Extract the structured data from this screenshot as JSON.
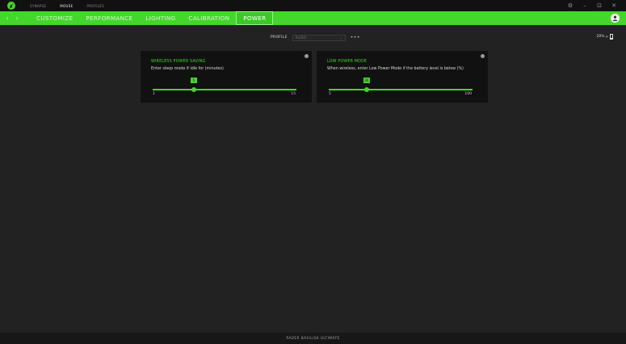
{
  "titlebar": {
    "tabs": [
      {
        "label": "SYNAPSE",
        "active": false
      },
      {
        "label": "MOUSE",
        "active": true
      },
      {
        "label": "PROFILES",
        "active": false
      }
    ],
    "controls": {
      "gear": "⚙",
      "minimize": "–",
      "maximize": "⊡",
      "close": "✕"
    }
  },
  "nav": {
    "back": "‹",
    "forward": "›",
    "tabs": [
      {
        "label": "CUSTOMIZE",
        "active": false
      },
      {
        "label": "PERFORMANCE",
        "active": false
      },
      {
        "label": "LIGHTING",
        "active": false
      },
      {
        "label": "CALIBRATION",
        "active": false
      },
      {
        "label": "POWER",
        "active": true
      }
    ]
  },
  "profile": {
    "label": "PROFILE",
    "selected": "RAZER",
    "chevron": "⌄",
    "more": "•••"
  },
  "battery": {
    "label": "20%",
    "level": 0.2
  },
  "cards": [
    {
      "title": "WIRELESS POWER SAVING",
      "description": "Enter sleep mode if idle for (minutes)",
      "slider": {
        "min": 1,
        "max": 15,
        "value": 5,
        "min_label": "1",
        "max_label": "15",
        "value_label": "5"
      }
    },
    {
      "title": "LOW POWER MODE",
      "description": "When wireless, enter Low Power Mode if the battery level is below (%)",
      "slider": {
        "min": 5,
        "max": 100,
        "value": 30,
        "min_label": "5",
        "max_label": "100",
        "value_label": "30"
      }
    }
  ],
  "footer": {
    "device": "RAZER BASILISK ULTIMATE"
  },
  "colors": {
    "accent": "#44d62c",
    "background": "#222222",
    "card": "#111111"
  }
}
